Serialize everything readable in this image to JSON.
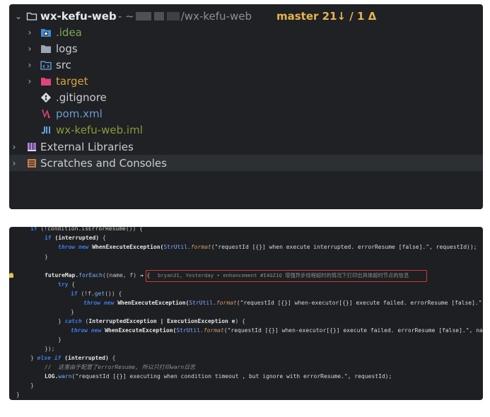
{
  "project_tree": {
    "root": {
      "name": "wx-kefu-web",
      "path_prefix": "- ~",
      "path_suffix": "/wx-kefu-web",
      "branch": "master 21↓ / 1 Δ"
    },
    "items": [
      {
        "label": ".idea",
        "icon": "folder-idea-icon",
        "color": "#7ea85a"
      },
      {
        "label": "logs",
        "icon": "folder-icon",
        "color": "#c9cdd3"
      },
      {
        "label": "src",
        "icon": "folder-source-icon",
        "color": "#c9cdd3"
      },
      {
        "label": "target",
        "icon": "folder-excluded-icon",
        "color": "#d7a340"
      },
      {
        "label": ".gitignore",
        "icon": "git-icon",
        "color": "#c9cdd3"
      },
      {
        "label": "pom.xml",
        "icon": "maven-icon",
        "color": "#6b9bd1"
      },
      {
        "label": "wx-kefu-web.iml",
        "icon": "iml-module-icon",
        "color": "#8a9a3a"
      }
    ],
    "external_libraries": "External Libraries",
    "scratches": "Scratches and Consoles"
  },
  "code": {
    "lines": [
      {
        "t": "if (!condition.isErrorResume()) {"
      },
      {
        "t": "if (interrupted) {"
      },
      {
        "t": "throw new WhenExecuteException(StrUtil.format(\"requestId [{}] when execute interrupted. errorResume [false].\", requestId));"
      },
      {
        "t": "}"
      },
      {
        "t": "futureMap.forEach((name, f) -> {"
      },
      {
        "t": "try {"
      },
      {
        "t": "if (!f.get()) {"
      },
      {
        "t": "throw new WhenExecuteException(StrUtil.format(\"requestId [{}] when-executor[{}] execute failed. errorResume [false].\", name,"
      },
      {
        "t": "}"
      },
      {
        "t": "} catch (InterruptedException | ExecutionException e) {"
      },
      {
        "t": "throw new WhenExecuteException(StrUtil.format(\"requestId [{}] when-executor[{}] execute failed. errorResume [false].\", name, re"
      },
      {
        "t": "}"
      },
      {
        "t": "});"
      },
      {
        "t": "} else if (interrupted) {"
      },
      {
        "t": "//  这里由于配置了errorResume, 所以只打印warn日志"
      },
      {
        "t": "LOG.warn(\"requestId [{}] executing when condition timeout , but ignore with errorResume.\", requestId);"
      },
      {
        "t": "}"
      },
      {
        "t": "}"
      }
    ],
    "blame": "bryan31, Yesterday • enhancement #I4GZ1Q 增强异步线程超时的情况下打印出具体超时节点的信息"
  }
}
